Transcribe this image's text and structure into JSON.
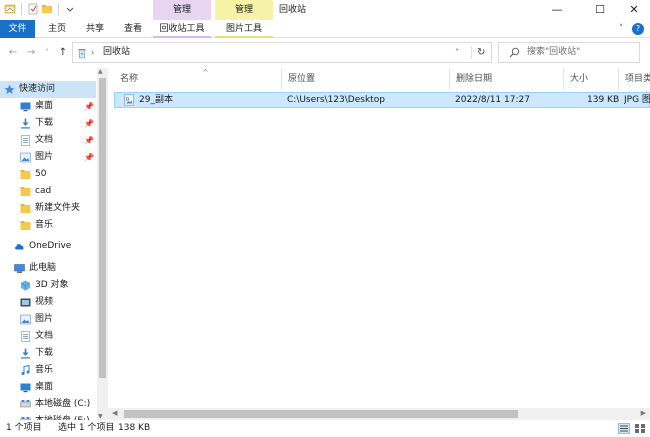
{
  "window": {
    "title": "回收站",
    "contextual_tab_1": "管理",
    "contextual_tab_2": "管理",
    "controls": {
      "minimize": "—",
      "maximize": "☐",
      "close": "✕"
    }
  },
  "ribbon": {
    "tabs": [
      {
        "label": "文件"
      },
      {
        "label": "主页"
      },
      {
        "label": "共享"
      },
      {
        "label": "查看"
      },
      {
        "label": "回收站工具"
      },
      {
        "label": "图片工具"
      }
    ],
    "expand_chevron": "˅",
    "help": "?"
  },
  "navigation": {
    "back": "←",
    "forward": "→",
    "recent": "˅",
    "up": "↑"
  },
  "address": {
    "path": "回收站",
    "chevron": "›",
    "dropdown": "˅",
    "refresh": "↻"
  },
  "search": {
    "placeholder": "搜索\"回收站\""
  },
  "sidebar": {
    "items": [
      {
        "label": "快速访问",
        "icon": "star-icon",
        "pinned": false
      },
      {
        "label": "桌面",
        "icon": "desktop-icon",
        "pinned": true
      },
      {
        "label": "下载",
        "icon": "download-icon",
        "pinned": true
      },
      {
        "label": "文档",
        "icon": "document-icon",
        "pinned": true
      },
      {
        "label": "图片",
        "icon": "picture-icon",
        "pinned": true
      },
      {
        "label": "50",
        "icon": "folder-icon",
        "pinned": false
      },
      {
        "label": "cad",
        "icon": "folder-icon",
        "pinned": false
      },
      {
        "label": "新建文件夹",
        "icon": "folder-icon",
        "pinned": false
      },
      {
        "label": "音乐",
        "icon": "folder-icon",
        "pinned": false
      },
      {
        "label": "OneDrive",
        "icon": "cloud-icon",
        "pinned": false
      },
      {
        "label": "此电脑",
        "icon": "computer-icon",
        "pinned": false
      },
      {
        "label": "3D 对象",
        "icon": "cube-icon",
        "pinned": false
      },
      {
        "label": "视频",
        "icon": "video-icon",
        "pinned": false
      },
      {
        "label": "图片",
        "icon": "picture-icon",
        "pinned": false
      },
      {
        "label": "文档",
        "icon": "document-icon",
        "pinned": false
      },
      {
        "label": "下载",
        "icon": "download-icon",
        "pinned": false
      },
      {
        "label": "音乐",
        "icon": "music-icon",
        "pinned": false
      },
      {
        "label": "桌面",
        "icon": "desktop-icon",
        "pinned": false
      },
      {
        "label": "本地磁盘 (C:)",
        "icon": "drive-icon",
        "pinned": false
      },
      {
        "label": "本地磁盘 (E:)",
        "icon": "drive-icon",
        "pinned": false
      }
    ],
    "pin_glyph": "📌"
  },
  "table": {
    "columns": [
      "名称",
      "原位置",
      "删除日期",
      "大小",
      "项目类"
    ],
    "sort_indicator": "^",
    "rows": [
      {
        "name": "29_副本",
        "origin": "C:\\Users\\123\\Desktop",
        "deleted": "2022/8/11 17:27",
        "size": "139 KB",
        "type": "JPG 图"
      }
    ]
  },
  "status": {
    "count": "1 个项目",
    "selected": "选中 1 个项目",
    "size": "138 KB"
  },
  "colors": {
    "accent": "#1a6fc9",
    "selection": "#cce8ff",
    "selection_border": "#99d1ff",
    "nav_selection": "#cce4f7",
    "folder": "#f4c94e"
  }
}
